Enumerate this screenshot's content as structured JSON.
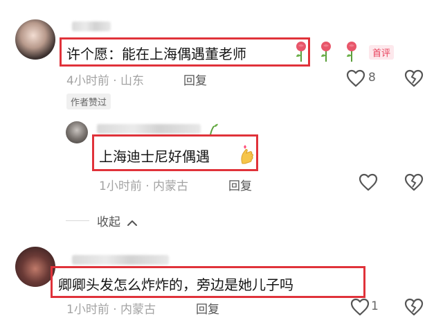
{
  "comments": [
    {
      "text": "许个愿：能在上海偶遇董老师",
      "meta": "4小时前 · 山东",
      "reply_label": "回复",
      "likes": "8",
      "author_badge": "作者赞过",
      "first_badge": "首评"
    },
    {
      "text": "上海迪士尼好偶遇",
      "meta": "1小时前 · 内蒙古",
      "reply_label": "回复"
    },
    {
      "text": "卿卿头发怎么炸炸的，旁边是她儿子吗",
      "meta": "1小时前 · 内蒙古",
      "reply_label": "回复",
      "likes": "1"
    }
  ],
  "collapse_label": "收起",
  "colors": {
    "highlight": "#e0323a",
    "first_badge": "#e8415b"
  },
  "icons": [
    "rose-emoji",
    "heart-outline-icon",
    "dislike-broken-heart-icon",
    "finger-heart-emoji",
    "chevron-up-icon"
  ]
}
